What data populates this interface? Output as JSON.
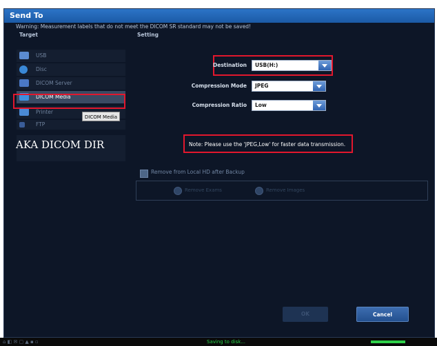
{
  "dialog": {
    "title": "Send To",
    "warning": "Warning: Measurement labels that do not meet the DICOM SR standard may not be saved!",
    "target_heading": "Target",
    "setting_heading": "Setting"
  },
  "targets": [
    {
      "label": "USB",
      "icon": "usb-icon",
      "color": "#5b8bd1"
    },
    {
      "label": "Disc",
      "icon": "disc-icon",
      "color": "#3a88d6"
    },
    {
      "label": "DICOM Server",
      "icon": "server-icon",
      "color": "#4a78c6"
    },
    {
      "label": "DICOM Media",
      "icon": "media-icon",
      "color": "#3d8fe0"
    },
    {
      "label": "Printer",
      "icon": "printer-icon",
      "color": "#4a8ad6"
    },
    {
      "label": "FTP",
      "icon": "ftp-icon",
      "color": "#3a5d99"
    }
  ],
  "selected_target_index": 3,
  "tooltip": "DICOM Media",
  "annotation": "AKA DICOM DIR",
  "settings": {
    "destination_label": "Destination",
    "destination_value": "USB(H:)",
    "compression_mode_label": "Compression Mode",
    "compression_mode_value": "JPEG",
    "compression_ratio_label": "Compression Ratio",
    "compression_ratio_value": "Low"
  },
  "note": "Note: Please use the 'JPEG,Low' for faster data transmission.",
  "remove_local_label": "Remove from Local HD after Backup",
  "remove_options": [
    "Remove Exams",
    "Remove Images"
  ],
  "buttons": {
    "ok": "OK",
    "cancel": "Cancel"
  },
  "status": {
    "text": "Saving to disk...",
    "progress": 1.0,
    "icons_text": "⌂ ◧ ✉ ▢ ▲ ▪ ▫"
  },
  "colors": {
    "accent": "#2c74c7",
    "highlight": "#e3172d",
    "status_green": "#29d34a"
  }
}
